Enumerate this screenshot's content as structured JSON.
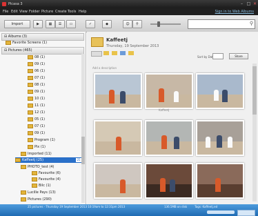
{
  "window": {
    "title": "Picasa 3"
  },
  "menu": {
    "items": [
      "File",
      "Edit",
      "View",
      "Folder",
      "Picture",
      "Create",
      "Tools",
      "Help"
    ],
    "signin": "Sign in to Web Albums"
  },
  "toolbar": {
    "import_label": "Import"
  },
  "left": {
    "albums": "Albums (3)",
    "favorites": "Favorite Screens (1)",
    "folders": "Pictures (465)",
    "tree": [
      "08 (1)",
      "09 (1)",
      "06 (1)",
      "07 (1)",
      "08 (1)",
      "09 (1)",
      "10 (1)",
      "11 (1)",
      "12 (1)",
      "05 (1)",
      "07 (1)",
      "09 (1)",
      "Program (1)",
      "Pix (1)",
      "Imported (11)",
      "Kaffeetj (25)",
      "PHOTO_test (4)",
      "Favourite (6)",
      "Favourite (4)",
      "Bilc (1)",
      "Lucille Pays (13)",
      "Pictures (290)"
    ],
    "selected_count": "25"
  },
  "content": {
    "folder_title": "Kaffeetj",
    "folder_date": "Thursday, 19 September 2013",
    "add_description": "Add a description",
    "sort_label": "Sort by Date",
    "share_label": "Share",
    "caption": "Kaffeetj"
  },
  "status": {
    "left": "25 pictures · Thursday 19 September 2013 10:19am to 12:31pm 2013",
    "mid": "136.5MB on disk",
    "right": "Tags: Kaffeetj.ed"
  },
  "colors": {
    "accent": "#2a70c9",
    "statusbar": "#1f6bb3"
  }
}
